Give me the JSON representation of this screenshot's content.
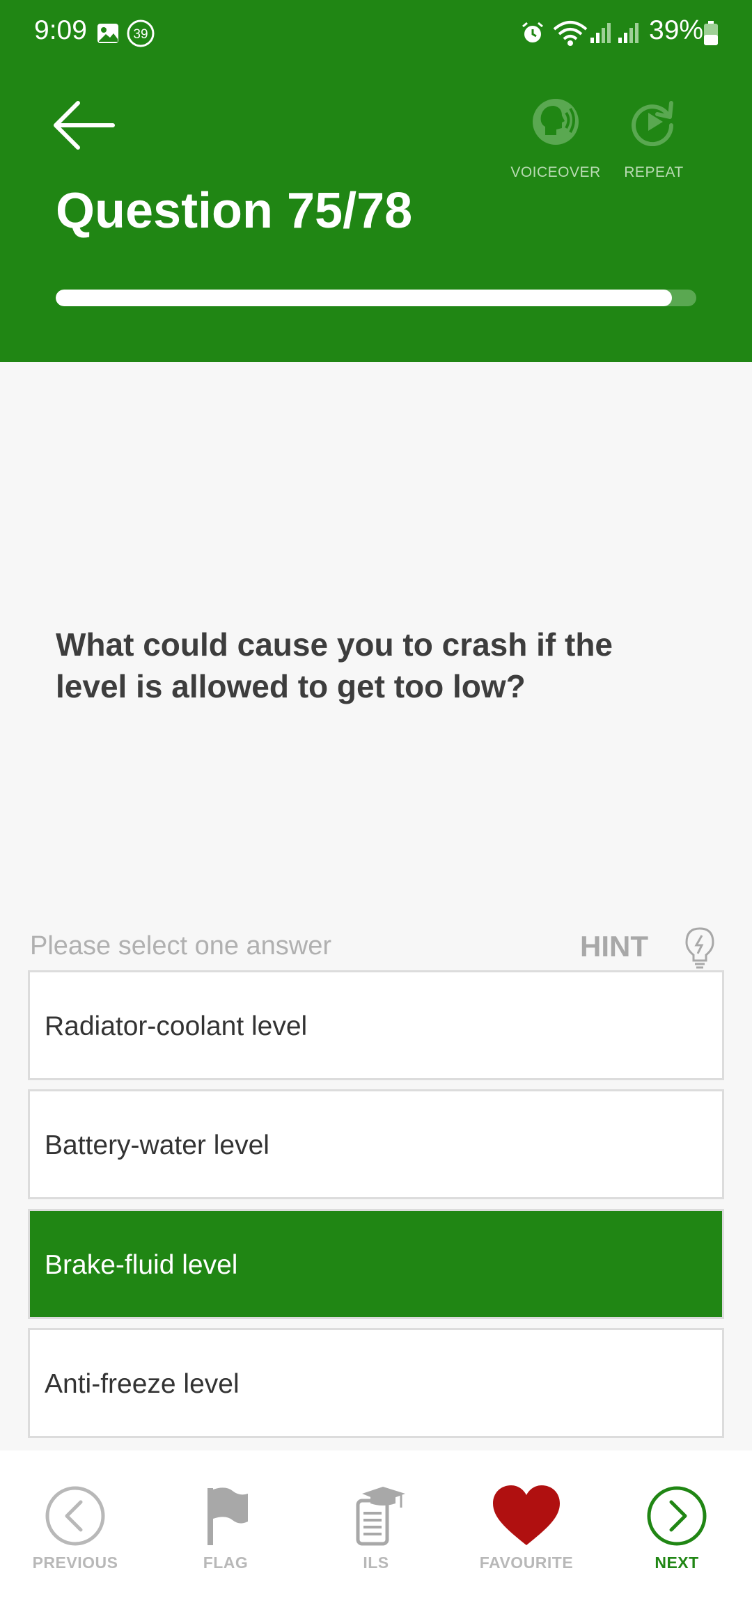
{
  "status_bar": {
    "time": "9:09",
    "notification_count": "39",
    "battery_percent": "39%"
  },
  "header": {
    "title": "Question 75/78",
    "progress_fraction": 0.9615,
    "actions": {
      "voiceover_label": "VOICEOVER",
      "repeat_label": "REPEAT"
    }
  },
  "question": {
    "text": "What could cause you to crash if the level is allowed to get too low?"
  },
  "answers_section": {
    "instruction": "Please select one answer",
    "hint_label": "HINT",
    "options": [
      {
        "label": "Radiator-coolant level",
        "selected": false
      },
      {
        "label": "Battery-water level",
        "selected": false
      },
      {
        "label": "Brake-fluid level",
        "selected": true
      },
      {
        "label": "Anti-freeze level",
        "selected": false
      }
    ]
  },
  "bottom_nav": {
    "previous": "PREVIOUS",
    "flag": "FLAG",
    "ils": "ILS",
    "favourite": "FAVOURITE",
    "next": "NEXT"
  },
  "colors": {
    "primary_green": "#208614",
    "favourite_red": "#b01010",
    "background": "#f7f7f7"
  }
}
